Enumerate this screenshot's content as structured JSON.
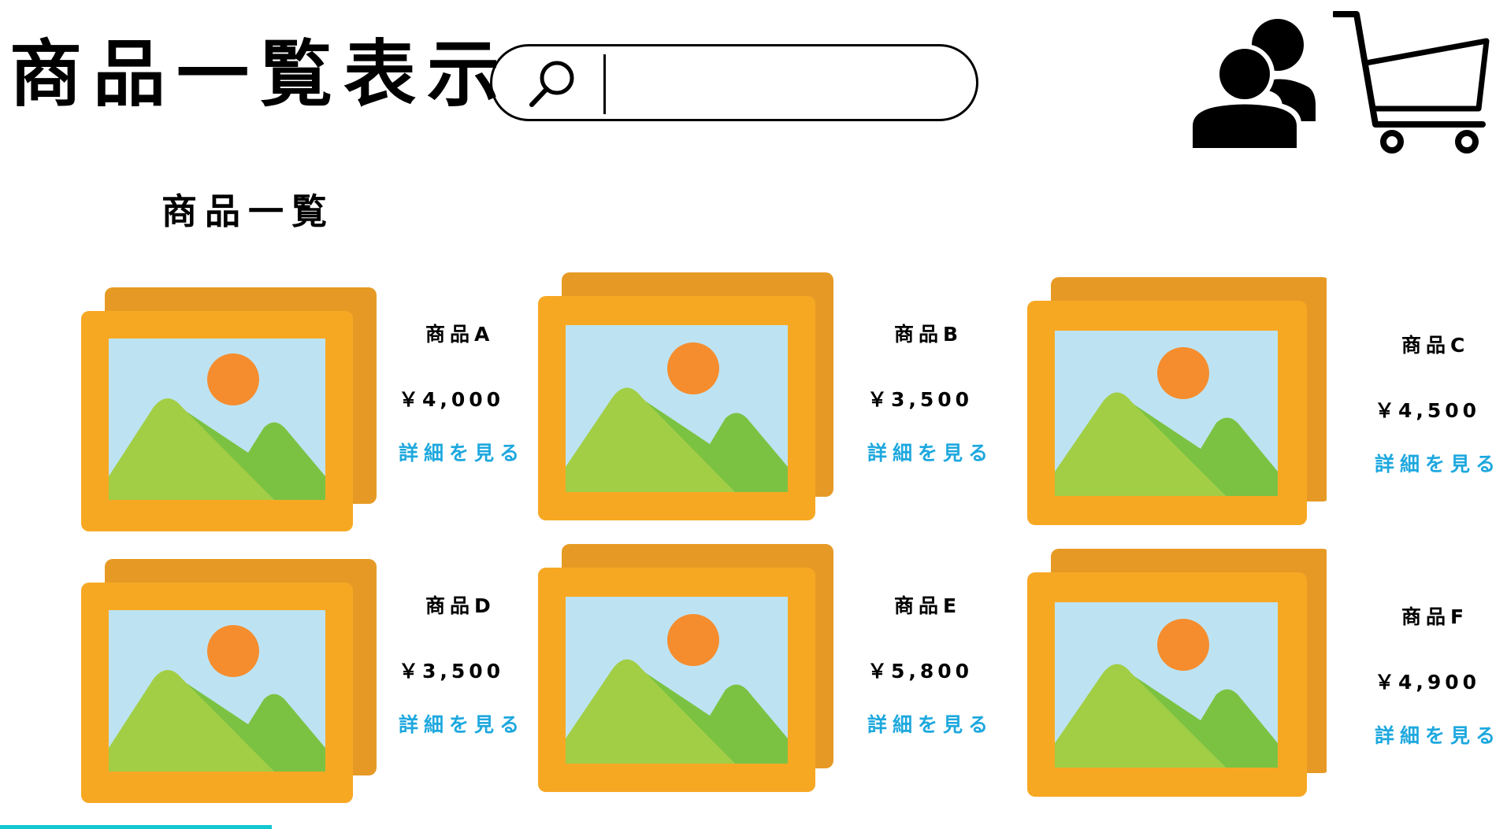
{
  "header": {
    "title": "商品一覧表示",
    "search": {
      "value": "",
      "placeholder": ""
    },
    "icons": [
      "search-icon",
      "users-icon",
      "cart-icon"
    ]
  },
  "section": {
    "title": "商品一覧"
  },
  "products": [
    {
      "name": "商品A",
      "price": "￥4,000",
      "link": "詳細を見る"
    },
    {
      "name": "商品B",
      "price": "￥3,500",
      "link": "詳細を見る"
    },
    {
      "name": "商品C",
      "price": "￥4,500",
      "link": "詳細を見る"
    },
    {
      "name": "商品D",
      "price": "￥3,500",
      "link": "詳細を見る"
    },
    {
      "name": "商品E",
      "price": "￥5,800",
      "link": "詳細を見る"
    },
    {
      "name": "商品F",
      "price": "￥4,900",
      "link": "詳細を見る"
    }
  ],
  "colors": {
    "link": "#1ea8de",
    "frame_back": "#e69a25",
    "frame_front": "#f7a823",
    "sky": "#bde3f3",
    "sun": "#f58d2e",
    "mountain_light": "#a2ce45",
    "mountain_dark": "#7cc242",
    "accent_bar": "#12c7cf"
  }
}
